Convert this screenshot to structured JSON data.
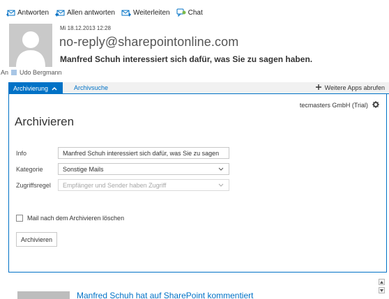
{
  "toolbar": {
    "reply": "Antworten",
    "reply_all": "Allen antworten",
    "forward": "Weiterleiten",
    "chat": "Chat"
  },
  "message": {
    "date": "Mi 18.12.2013 12:28",
    "sender": "no-reply@sharepointonline.com",
    "subject": "Manfred Schuh interessiert sich dafür, was Sie zu sagen haben.",
    "to_label": "An",
    "recipient": "Udo Bergmann"
  },
  "tabs": {
    "active": "Archivierung",
    "second": "Archivsuche",
    "more_apps": "Weitere Apps abrufen"
  },
  "panel": {
    "tenant": "tecmasters GmbH (Trial)",
    "title": "Archivieren",
    "info_label": "Info",
    "info_value": "Manfred Schuh interessiert sich dafür, was Sie zu sagen",
    "category_label": "Kategorie",
    "category_value": "Sonstige Mails",
    "access_label": "Zugriffsregel",
    "access_value": "Empfänger und Sender haben Zugriff",
    "delete_checkbox": "Mail nach dem Archivieren löschen",
    "archive_button": "Archivieren"
  },
  "bottom": {
    "link_text": "Manfred Schuh hat auf SharePoint kommentiert"
  },
  "colors": {
    "accent": "#0072c6",
    "tab_bar": "#f1f1f1",
    "avatar_bg": "#c9c9c9"
  },
  "icons": [
    "reply-icon",
    "reply-all-icon",
    "forward-icon",
    "chat-icon",
    "chevron-up-icon",
    "plus-icon",
    "gear-icon",
    "chevron-down-icon",
    "scroll-up-icon",
    "scroll-down-icon"
  ]
}
